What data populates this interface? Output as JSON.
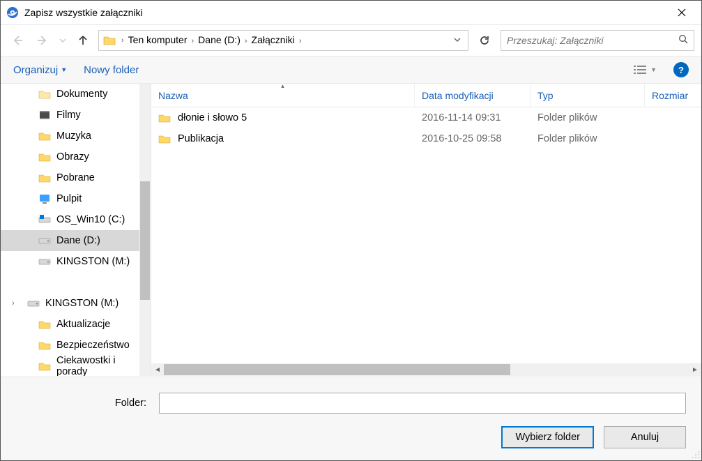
{
  "window": {
    "title": "Zapisz wszystkie załączniki"
  },
  "nav": {
    "breadcrumbs": [
      "Ten komputer",
      "Dane (D:)",
      "Załączniki"
    ],
    "search_placeholder": "Przeszukaj: Załączniki"
  },
  "toolbar": {
    "organize": "Organizuj",
    "new_folder": "Nowy folder",
    "help": "?"
  },
  "sidebar": {
    "items": [
      {
        "label": "Dokumenty",
        "icon": "docs",
        "indent": true
      },
      {
        "label": "Filmy",
        "icon": "video",
        "indent": true
      },
      {
        "label": "Muzyka",
        "icon": "music",
        "indent": true
      },
      {
        "label": "Obrazy",
        "icon": "pics",
        "indent": true
      },
      {
        "label": "Pobrane",
        "icon": "dl",
        "indent": true
      },
      {
        "label": "Pulpit",
        "icon": "desk",
        "indent": true
      },
      {
        "label": "OS_Win10 (C:)",
        "icon": "drive-win",
        "indent": true
      },
      {
        "label": "Dane (D:)",
        "icon": "drive",
        "indent": true,
        "selected": true
      },
      {
        "label": "KINGSTON (M:)",
        "icon": "drive",
        "indent": true
      },
      {
        "label": "",
        "icon": "blank",
        "indent": false
      },
      {
        "label": "KINGSTON (M:)",
        "icon": "drive",
        "indent": false,
        "expandable": true
      },
      {
        "label": "Aktualizacje",
        "icon": "folder",
        "indent": true
      },
      {
        "label": "Bezpieczeństwo",
        "icon": "folder",
        "indent": true
      },
      {
        "label": "Ciekawostki i porady",
        "icon": "folder",
        "indent": true
      }
    ]
  },
  "columns": {
    "name": "Nazwa",
    "date": "Data modyfikacji",
    "type": "Typ",
    "size": "Rozmiar"
  },
  "files": [
    {
      "name": "dłonie i słowo 5",
      "date": "2016-11-14 09:31",
      "type": "Folder plików"
    },
    {
      "name": "Publikacja",
      "date": "2016-10-25 09:58",
      "type": "Folder plików"
    }
  ],
  "bottom": {
    "folder_label": "Folder:",
    "folder_value": "",
    "select": "Wybierz folder",
    "cancel": "Anuluj"
  },
  "col_widths": {
    "name": 362,
    "date": 166,
    "type": 164,
    "size": 80
  }
}
